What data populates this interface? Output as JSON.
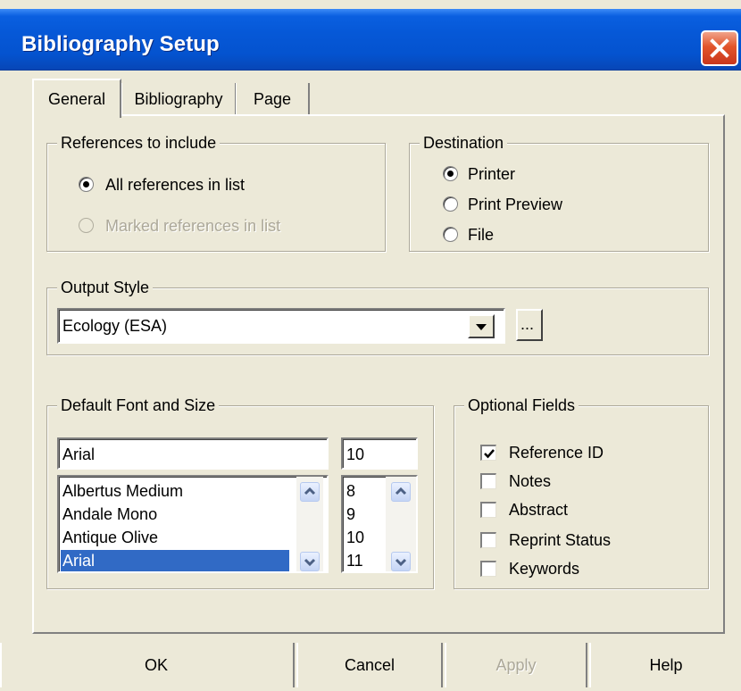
{
  "window": {
    "title": "Bibliography Setup"
  },
  "tabs": [
    {
      "label": "General",
      "active": true
    },
    {
      "label": "Bibliography",
      "active": false
    },
    {
      "label": "Page",
      "active": false
    }
  ],
  "references": {
    "legend": "References to include",
    "options": [
      {
        "label": "All references in list",
        "checked": true,
        "disabled": false
      },
      {
        "label": "Marked references in list",
        "checked": false,
        "disabled": true
      }
    ]
  },
  "destination": {
    "legend": "Destination",
    "options": [
      {
        "label": "Printer",
        "checked": true
      },
      {
        "label": "Print Preview",
        "checked": false
      },
      {
        "label": "File",
        "checked": false
      }
    ]
  },
  "output_style": {
    "legend": "Output Style",
    "selected": "Ecology (ESA)",
    "browse_label": "..."
  },
  "font": {
    "legend": "Default Font and Size",
    "font_value": "Arial",
    "size_value": "10",
    "font_list": [
      "Albertus Medium",
      "Andale Mono",
      "Antique Olive",
      "Arial"
    ],
    "font_selected_index": 3,
    "size_list": [
      "8",
      "9",
      "10",
      "11"
    ]
  },
  "optional_fields": {
    "legend": "Optional Fields",
    "items": [
      {
        "label": "Reference ID",
        "checked": true
      },
      {
        "label": "Notes",
        "checked": false
      },
      {
        "label": "Abstract",
        "checked": false
      },
      {
        "label": "Reprint Status",
        "checked": false
      },
      {
        "label": "Keywords",
        "checked": false
      }
    ]
  },
  "buttons": {
    "ok": "OK",
    "cancel": "Cancel",
    "apply": "Apply",
    "help": "Help"
  },
  "colors": {
    "titlebar": "#0453cf",
    "dialog_bg": "#ece9d8",
    "selection": "#316ac5",
    "close_button": "#e2552b"
  }
}
